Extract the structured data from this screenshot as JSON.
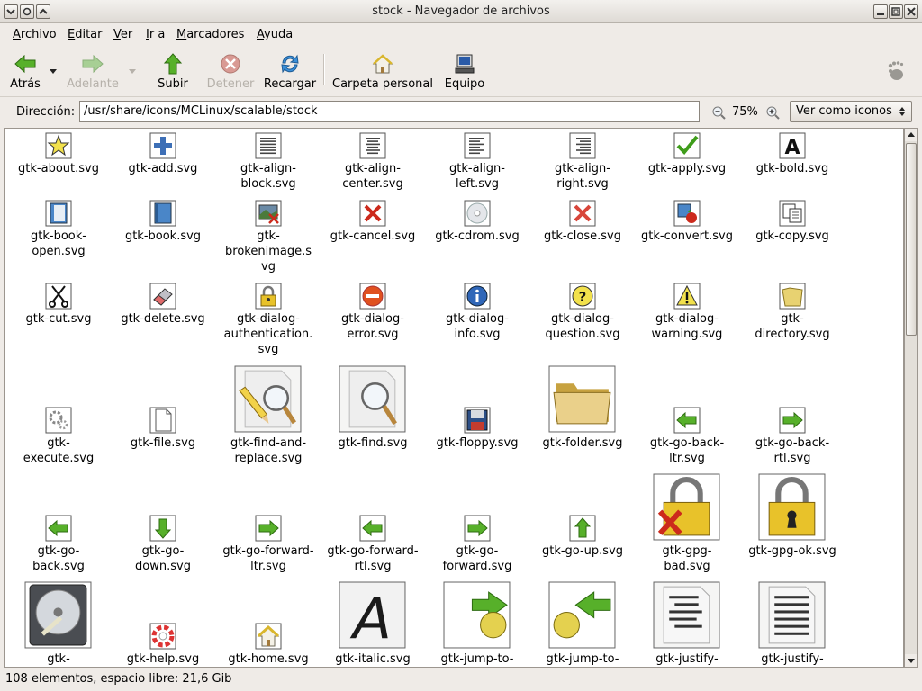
{
  "window": {
    "title": "stock - Navegador de archivos"
  },
  "menu": [
    {
      "label": "Archivo",
      "u": "A",
      "rest": "rchivo"
    },
    {
      "label": "Editar",
      "u": "E",
      "rest": "ditar"
    },
    {
      "label": "Ver",
      "u": "V",
      "rest": "er"
    },
    {
      "label": "Ir a",
      "u": "I",
      "rest": "r a"
    },
    {
      "label": "Marcadores",
      "u": "M",
      "rest": "arcadores"
    },
    {
      "label": "Ayuda",
      "u": "A",
      "rest": "yuda"
    }
  ],
  "toolbar": {
    "back": "Atrás",
    "forward": "Adelante",
    "up": "Subir",
    "stop": "Detener",
    "reload": "Recargar",
    "home": "Carpeta personal",
    "computer": "Equipo"
  },
  "location": {
    "label": "Dirección:",
    "path": "/usr/share/icons/MCLinux/scalable/stock",
    "zoom": "75%",
    "view": "Ver como iconos"
  },
  "files": [
    {
      "l1": "gtk-about.svg",
      "l2": "",
      "l3": "",
      "icon": "star"
    },
    {
      "l1": "gtk-add.svg",
      "l2": "",
      "l3": "",
      "icon": "plus"
    },
    {
      "l1": "gtk-align-",
      "l2": "block.svg",
      "l3": "",
      "icon": "align-block"
    },
    {
      "l1": "gtk-align-",
      "l2": "center.svg",
      "l3": "",
      "icon": "align-center"
    },
    {
      "l1": "gtk-align-",
      "l2": "left.svg",
      "l3": "",
      "icon": "align-left"
    },
    {
      "l1": "gtk-align-",
      "l2": "right.svg",
      "l3": "",
      "icon": "align-right"
    },
    {
      "l1": "gtk-apply.svg",
      "l2": "",
      "l3": "",
      "icon": "check"
    },
    {
      "l1": "gtk-bold.svg",
      "l2": "",
      "l3": "",
      "icon": "bold"
    },
    {
      "l1": "gtk-book-",
      "l2": "open.svg",
      "l3": "",
      "icon": "book-open"
    },
    {
      "l1": "gtk-book.svg",
      "l2": "",
      "l3": "",
      "icon": "book"
    },
    {
      "l1": "gtk-",
      "l2": "brokenimage.s",
      "l3": "vg",
      "icon": "brokenimage"
    },
    {
      "l1": "gtk-cancel.svg",
      "l2": "",
      "l3": "",
      "icon": "cancel"
    },
    {
      "l1": "gtk-cdrom.svg",
      "l2": "",
      "l3": "",
      "icon": "cdrom"
    },
    {
      "l1": "gtk-close.svg",
      "l2": "",
      "l3": "",
      "icon": "close"
    },
    {
      "l1": "gtk-convert.svg",
      "l2": "",
      "l3": "",
      "icon": "convert"
    },
    {
      "l1": "gtk-copy.svg",
      "l2": "",
      "l3": "",
      "icon": "copy"
    },
    {
      "l1": "gtk-cut.svg",
      "l2": "",
      "l3": "",
      "icon": "cut"
    },
    {
      "l1": "gtk-delete.svg",
      "l2": "",
      "l3": "",
      "icon": "delete"
    },
    {
      "l1": "gtk-dialog-",
      "l2": "authentication.",
      "l3": "svg",
      "icon": "lock-small"
    },
    {
      "l1": "gtk-dialog-",
      "l2": "error.svg",
      "l3": "",
      "icon": "error"
    },
    {
      "l1": "gtk-dialog-",
      "l2": "info.svg",
      "l3": "",
      "icon": "info"
    },
    {
      "l1": "gtk-dialog-",
      "l2": "question.svg",
      "l3": "",
      "icon": "question"
    },
    {
      "l1": "gtk-dialog-",
      "l2": "warning.svg",
      "l3": "",
      "icon": "warning"
    },
    {
      "l1": "gtk-",
      "l2": "directory.svg",
      "l3": "",
      "icon": "directory"
    },
    {
      "l1": "gtk-",
      "l2": "execute.svg",
      "l3": "",
      "icon": "execute"
    },
    {
      "l1": "gtk-file.svg",
      "l2": "",
      "l3": "",
      "icon": "file"
    },
    {
      "l1": "gtk-find-and-",
      "l2": "replace.svg",
      "l3": "",
      "icon": "find-replace"
    },
    {
      "l1": "gtk-find.svg",
      "l2": "",
      "l3": "",
      "icon": "find"
    },
    {
      "l1": "gtk-floppy.svg",
      "l2": "",
      "l3": "",
      "icon": "floppy"
    },
    {
      "l1": "gtk-folder.svg",
      "l2": "",
      "l3": "",
      "icon": "folder"
    },
    {
      "l1": "gtk-go-back-",
      "l2": "ltr.svg",
      "l3": "",
      "icon": "arrow-left"
    },
    {
      "l1": "gtk-go-back-",
      "l2": "rtl.svg",
      "l3": "",
      "icon": "arrow-right"
    },
    {
      "l1": "gtk-go-",
      "l2": "back.svg",
      "l3": "",
      "icon": "arrow-left"
    },
    {
      "l1": "gtk-go-",
      "l2": "down.svg",
      "l3": "",
      "icon": "arrow-down"
    },
    {
      "l1": "gtk-go-forward-",
      "l2": "ltr.svg",
      "l3": "",
      "icon": "arrow-right"
    },
    {
      "l1": "gtk-go-forward-",
      "l2": "rtl.svg",
      "l3": "",
      "icon": "arrow-left"
    },
    {
      "l1": "gtk-go-",
      "l2": "forward.svg",
      "l3": "",
      "icon": "arrow-right"
    },
    {
      "l1": "gtk-go-up.svg",
      "l2": "",
      "l3": "",
      "icon": "arrow-up"
    },
    {
      "l1": "gtk-gpg-",
      "l2": "bad.svg",
      "l3": "",
      "icon": "gpg-bad"
    },
    {
      "l1": "gtk-gpg-ok.svg",
      "l2": "",
      "l3": "",
      "icon": "gpg-ok"
    },
    {
      "l1": "gtk-",
      "l2": "",
      "l3": "",
      "icon": "harddisk"
    },
    {
      "l1": "gtk-help.svg",
      "l2": "",
      "l3": "",
      "icon": "help"
    },
    {
      "l1": "gtk-home.svg",
      "l2": "",
      "l3": "",
      "icon": "home"
    },
    {
      "l1": "gtk-italic.svg",
      "l2": "",
      "l3": "",
      "icon": "italic"
    },
    {
      "l1": "gtk-jump-to-",
      "l2": "",
      "l3": "",
      "icon": "jump-ltr"
    },
    {
      "l1": "gtk-jump-to-",
      "l2": "",
      "l3": "",
      "icon": "jump-rtl"
    },
    {
      "l1": "gtk-justify-",
      "l2": "",
      "l3": "",
      "icon": "justify-big"
    },
    {
      "l1": "gtk-justify-",
      "l2": "",
      "l3": "",
      "icon": "justify-fill"
    }
  ],
  "status": {
    "text": "108 elementos, espacio libre: 21,6 Gib"
  },
  "colors": {
    "accent_green": "#3f9d1b",
    "danger_red": "#cc2a1c",
    "folder_yellow": "#e8d271"
  }
}
